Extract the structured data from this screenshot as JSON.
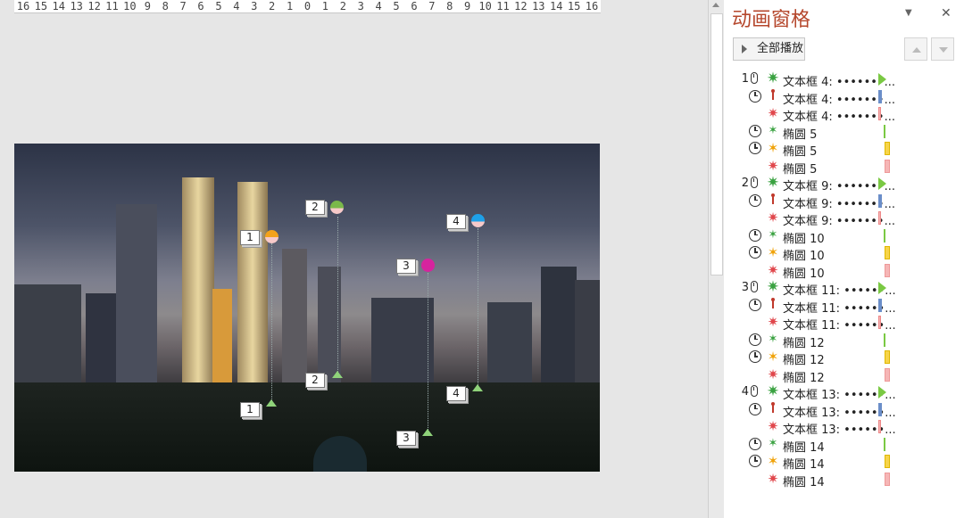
{
  "ruler": {
    "ticks": [
      "16",
      "15",
      "14",
      "13",
      "12",
      "11",
      "10",
      "9",
      "8",
      "7",
      "6",
      "5",
      "4",
      "3",
      "2",
      "1",
      "0",
      "1",
      "2",
      "3",
      "4",
      "5",
      "6",
      "7",
      "8",
      "9",
      "10",
      "11",
      "12",
      "13",
      "14",
      "15",
      "16"
    ]
  },
  "slide_tags": [
    {
      "label": "1",
      "kind": "start"
    },
    {
      "label": "2",
      "kind": "start"
    },
    {
      "label": "3",
      "kind": "start"
    },
    {
      "label": "4",
      "kind": "start"
    },
    {
      "label": "1",
      "kind": "end"
    },
    {
      "label": "2",
      "kind": "end"
    },
    {
      "label": "3",
      "kind": "end"
    },
    {
      "label": "4",
      "kind": "end"
    }
  ],
  "pane": {
    "title": "动画窗格",
    "dropdown_icon": "dropdown-arrow-icon",
    "close_icon": "close-icon",
    "play_all": "全部播放",
    "move_up_icon": "move-up-arrow-icon",
    "move_down_icon": "move-down-arrow-icon"
  },
  "animation_items": [
    {
      "num": "1",
      "trigger": "mouse",
      "effect": "entrance",
      "label": "文本框 4: •••••••...",
      "bar": "green-play"
    },
    {
      "num": "",
      "trigger": "clock",
      "effect": "path",
      "label": "文本框 4: •••••••...",
      "bar": "blue"
    },
    {
      "num": "",
      "trigger": "none",
      "effect": "exit",
      "label": "文本框 4: •••••••...",
      "bar": "pink-thin"
    },
    {
      "num": "",
      "trigger": "clock",
      "effect": "entrance-small",
      "label": "椭圆 5",
      "bar": "green-line"
    },
    {
      "num": "",
      "trigger": "clock",
      "effect": "emphasis",
      "label": "椭圆 5",
      "bar": "yellow"
    },
    {
      "num": "",
      "trigger": "none",
      "effect": "exit",
      "label": "椭圆 5",
      "bar": "pink"
    },
    {
      "num": "2",
      "trigger": "mouse",
      "effect": "entrance",
      "label": "文本框 9: •••••••...",
      "bar": "green-play"
    },
    {
      "num": "",
      "trigger": "clock",
      "effect": "path",
      "label": "文本框 9: •••••••...",
      "bar": "blue"
    },
    {
      "num": "",
      "trigger": "none",
      "effect": "exit",
      "label": "文本框 9: •••••••...",
      "bar": "pink-thin"
    },
    {
      "num": "",
      "trigger": "clock",
      "effect": "entrance-small",
      "label": "椭圆 10",
      "bar": "green-line"
    },
    {
      "num": "",
      "trigger": "clock",
      "effect": "emphasis",
      "label": "椭圆 10",
      "bar": "yellow"
    },
    {
      "num": "",
      "trigger": "none",
      "effect": "exit",
      "label": "椭圆 10",
      "bar": "pink"
    },
    {
      "num": "3",
      "trigger": "mouse",
      "effect": "entrance",
      "label": "文本框 11: ••••••...",
      "bar": "green-play"
    },
    {
      "num": "",
      "trigger": "clock",
      "effect": "path",
      "label": "文本框 11: ••••••...",
      "bar": "blue"
    },
    {
      "num": "",
      "trigger": "none",
      "effect": "exit",
      "label": "文本框 11: ••••••...",
      "bar": "pink-thin"
    },
    {
      "num": "",
      "trigger": "clock",
      "effect": "entrance-small",
      "label": "椭圆 12",
      "bar": "green-line"
    },
    {
      "num": "",
      "trigger": "clock",
      "effect": "emphasis",
      "label": "椭圆 12",
      "bar": "yellow"
    },
    {
      "num": "",
      "trigger": "none",
      "effect": "exit",
      "label": "椭圆 12",
      "bar": "pink"
    },
    {
      "num": "4",
      "trigger": "mouse",
      "effect": "entrance",
      "label": "文本框 13: ••••••...",
      "bar": "green-play"
    },
    {
      "num": "",
      "trigger": "clock",
      "effect": "path",
      "label": "文本框 13: ••••••...",
      "bar": "blue"
    },
    {
      "num": "",
      "trigger": "none",
      "effect": "exit",
      "label": "文本框 13: ••••••...",
      "bar": "pink-thin"
    },
    {
      "num": "",
      "trigger": "clock",
      "effect": "entrance-small",
      "label": "椭圆 14",
      "bar": "green-line"
    },
    {
      "num": "",
      "trigger": "clock",
      "effect": "emphasis",
      "label": "椭圆 14",
      "bar": "yellow"
    },
    {
      "num": "",
      "trigger": "none",
      "effect": "exit",
      "label": "椭圆 14",
      "bar": "pink"
    }
  ],
  "colors": {
    "title": "#b5472c",
    "entrance": "#3aa241",
    "emphasis": "#f0a30a",
    "exit": "#e0474c",
    "path": "#c0392b",
    "bar_blue": "#6b8ec9",
    "bar_yellow": "#f7d44a",
    "bar_pink": "#f6b6b6",
    "bar_green": "#7ac943"
  }
}
